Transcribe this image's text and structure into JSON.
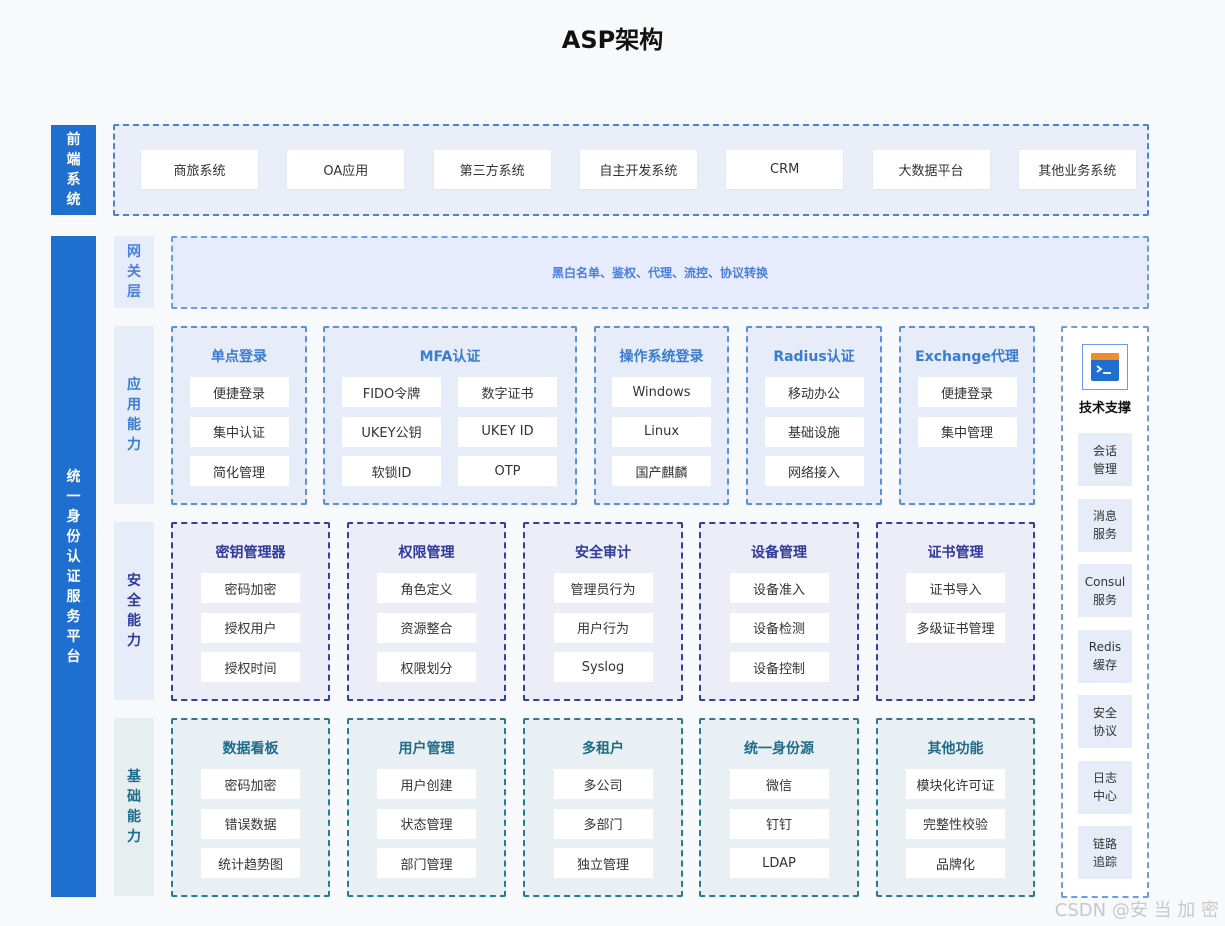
{
  "title": "ASP架构",
  "frontend": {
    "label": "前端系统",
    "items": [
      "商旅系统",
      "OA应用",
      "第三方系统",
      "自主开发系统",
      "CRM",
      "大数据平台",
      "其他业务系统"
    ]
  },
  "platform_label": "统一身份认证服务平台",
  "gateway": {
    "label": "网关层",
    "text": "黑白名单、鉴权、代理、流控、协议转换"
  },
  "app_layer": {
    "label": "应用能力",
    "modules": [
      {
        "title": "单点登录",
        "items": [
          "便捷登录",
          "集中认证",
          "简化管理"
        ]
      },
      {
        "title": "MFA认证",
        "items": [
          "FIDO令牌",
          "数字证书",
          "UKEY公钥",
          "UKEY ID",
          "软锁ID",
          "OTP"
        ]
      },
      {
        "title": "操作系统登录",
        "items": [
          "Windows",
          "Linux",
          "国产麒麟"
        ]
      },
      {
        "title": "Radius认证",
        "items": [
          "移动办公",
          "基础设施",
          "网络接入"
        ]
      },
      {
        "title": "Exchange代理",
        "items": [
          "便捷登录",
          "集中管理"
        ]
      }
    ]
  },
  "security_layer": {
    "label": "安全能力",
    "modules": [
      {
        "title": "密钥管理器",
        "items": [
          "密码加密",
          "授权用户",
          "授权时间"
        ]
      },
      {
        "title": "权限管理",
        "items": [
          "角色定义",
          "资源整合",
          "权限划分"
        ]
      },
      {
        "title": "安全审计",
        "items": [
          "管理员行为",
          "用户行为",
          "Syslog"
        ]
      },
      {
        "title": "设备管理",
        "items": [
          "设备准入",
          "设备检测",
          "设备控制"
        ]
      },
      {
        "title": "证书管理",
        "items": [
          "证书导入",
          "多级证书管理"
        ]
      }
    ]
  },
  "base_layer": {
    "label": "基础能力",
    "modules": [
      {
        "title": "数据看板",
        "items": [
          "密码加密",
          "错误数据",
          "统计趋势图"
        ]
      },
      {
        "title": "用户管理",
        "items": [
          "用户创建",
          "状态管理",
          "部门管理"
        ]
      },
      {
        "title": "多租户",
        "items": [
          "多公司",
          "多部门",
          "独立管理"
        ]
      },
      {
        "title": "统一身份源",
        "items": [
          "微信",
          "钉钉",
          "LDAP"
        ]
      },
      {
        "title": "其他功能",
        "items": [
          "模块化许可证",
          "完整性校验",
          "品牌化"
        ]
      }
    ]
  },
  "tech_support": {
    "title": "技术支撑",
    "icon": "terminal-icon",
    "items": [
      "会话\n管理",
      "消息\n服务",
      "Consul\n服务",
      "Redis\n缓存",
      "安全\n协议",
      "日志\n中心",
      "链路\n追踪"
    ]
  },
  "colors": {
    "primary": "#1e6fcf",
    "app_accent": "#3a7bd5",
    "security_accent": "#2f3a9e",
    "base_accent": "#1f6b8a"
  },
  "watermark": "CSDN @安 当 加 密"
}
